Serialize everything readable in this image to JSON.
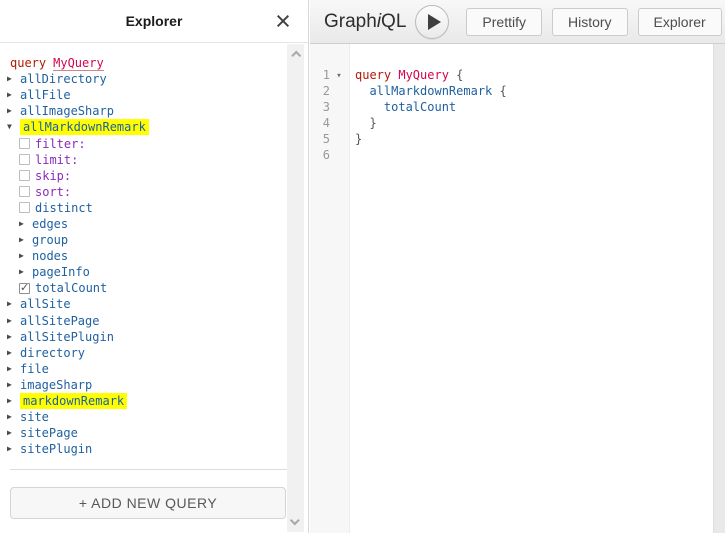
{
  "colors": {
    "kw": "#B11A04",
    "def": "#D2054E",
    "prop": "#1F61A0",
    "attr": "#8B2BB9",
    "pun": "#555555",
    "highlight": "#FFFF00"
  },
  "explorer": {
    "title": "Explorer",
    "close_label": "×",
    "query_keyword": "query",
    "query_name": "MyQuery",
    "add_button": "+ ADD NEW QUERY",
    "tree": [
      {
        "kind": "field",
        "level": 0,
        "arrow": "right",
        "label": "allDirectory"
      },
      {
        "kind": "field",
        "level": 0,
        "arrow": "right",
        "label": "allFile"
      },
      {
        "kind": "field",
        "level": 0,
        "arrow": "right",
        "label": "allImageSharp"
      },
      {
        "kind": "field",
        "level": 0,
        "arrow": "down",
        "label": "allMarkdownRemark",
        "highlight": true
      },
      {
        "kind": "arg",
        "level": 1,
        "checked": false,
        "label": "filter:"
      },
      {
        "kind": "arg",
        "level": 1,
        "checked": false,
        "label": "limit:"
      },
      {
        "kind": "arg",
        "level": 1,
        "checked": false,
        "label": "skip:"
      },
      {
        "kind": "arg",
        "level": 1,
        "checked": false,
        "label": "sort:"
      },
      {
        "kind": "leaf",
        "level": 1,
        "checked": false,
        "label": "distinct"
      },
      {
        "kind": "field",
        "level": 1,
        "arrow": "right",
        "label": "edges"
      },
      {
        "kind": "field",
        "level": 1,
        "arrow": "right",
        "label": "group"
      },
      {
        "kind": "field",
        "level": 1,
        "arrow": "right",
        "label": "nodes"
      },
      {
        "kind": "field",
        "level": 1,
        "arrow": "right",
        "label": "pageInfo"
      },
      {
        "kind": "leaf",
        "level": 1,
        "checked": true,
        "label": "totalCount"
      },
      {
        "kind": "field",
        "level": 0,
        "arrow": "right",
        "label": "allSite"
      },
      {
        "kind": "field",
        "level": 0,
        "arrow": "right",
        "label": "allSitePage"
      },
      {
        "kind": "field",
        "level": 0,
        "arrow": "right",
        "label": "allSitePlugin"
      },
      {
        "kind": "field",
        "level": 0,
        "arrow": "right",
        "label": "directory"
      },
      {
        "kind": "field",
        "level": 0,
        "arrow": "right",
        "label": "file"
      },
      {
        "kind": "field",
        "level": 0,
        "arrow": "right",
        "label": "imageSharp"
      },
      {
        "kind": "field",
        "level": 0,
        "arrow": "right",
        "label": "markdownRemark",
        "highlight": true
      },
      {
        "kind": "field",
        "level": 0,
        "arrow": "right",
        "label": "site"
      },
      {
        "kind": "field",
        "level": 0,
        "arrow": "right",
        "label": "sitePage"
      },
      {
        "kind": "field",
        "level": 0,
        "arrow": "right",
        "label": "sitePlugin"
      }
    ]
  },
  "toolbar": {
    "logo_pre": "Graph",
    "logo_italic": "i",
    "logo_post": "QL",
    "buttons": [
      "Prettify",
      "History",
      "Explorer"
    ]
  },
  "editor": {
    "lines": [
      {
        "n": "1",
        "fold": "▾",
        "tokens": [
          [
            "query ",
            "kw"
          ],
          [
            "MyQuery ",
            "def"
          ],
          [
            "{",
            "pun"
          ]
        ]
      },
      {
        "n": "2",
        "fold": "",
        "tokens": [
          [
            "  ",
            "pln"
          ],
          [
            "allMarkdownRemark ",
            "prop"
          ],
          [
            "{",
            "pun"
          ]
        ]
      },
      {
        "n": "3",
        "fold": "",
        "tokens": [
          [
            "    ",
            "pln"
          ],
          [
            "totalCount",
            "prop"
          ]
        ]
      },
      {
        "n": "4",
        "fold": "",
        "tokens": [
          [
            "  ",
            "pln"
          ],
          [
            "}",
            "pun"
          ]
        ]
      },
      {
        "n": "5",
        "fold": "",
        "tokens": [
          [
            "}",
            "pun"
          ]
        ]
      },
      {
        "n": "6",
        "fold": "",
        "tokens": []
      }
    ]
  }
}
